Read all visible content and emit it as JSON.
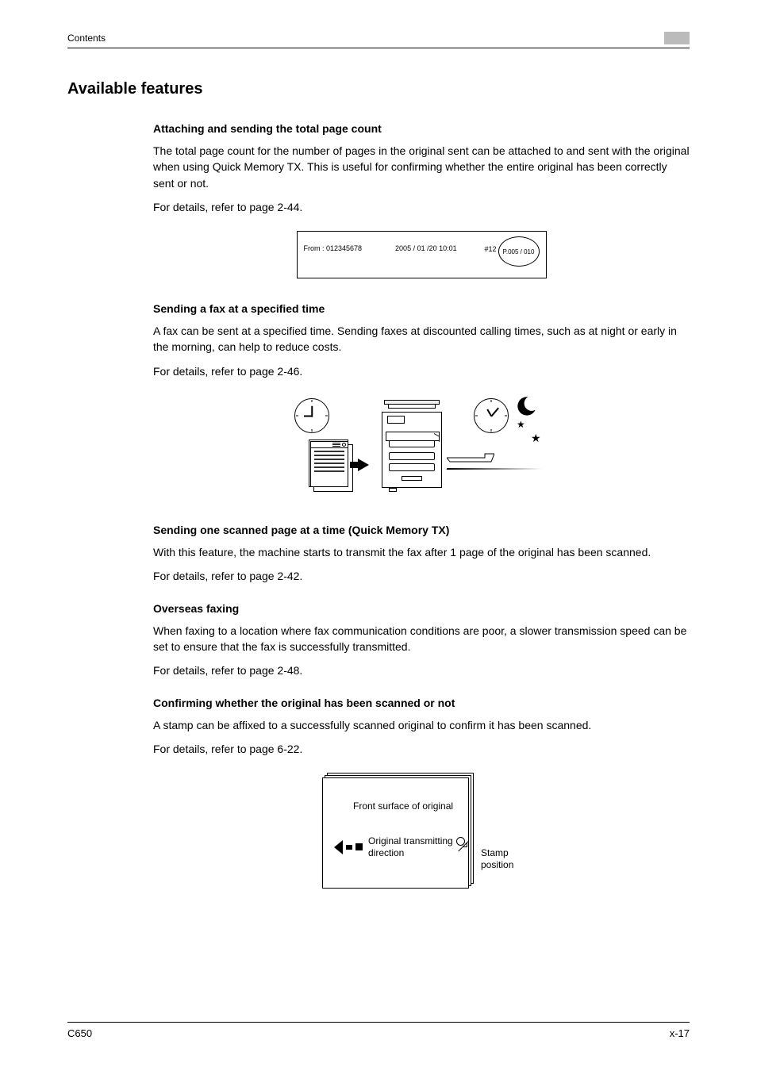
{
  "header": {
    "left": "Contents"
  },
  "title": "Available features",
  "sections": [
    {
      "heading": "Attaching and sending the total page count",
      "para1": "The total page count for the number of pages in the original sent can be attached to and sent with the original when using Quick Memory TX. This is useful for confirming whether the entire original has been correctly sent or not.",
      "para2": "For details, refer to page 2-44."
    },
    {
      "heading": "Sending a fax at a specified time",
      "para1": "A fax can be sent at a specified time. Sending faxes at discounted calling times, such as at night or early in the morning, can help to reduce costs.",
      "para2": "For details, refer to page 2-46."
    },
    {
      "heading": "Sending one scanned page at a time (Quick Memory TX)",
      "para1": "With this feature, the machine starts to transmit the fax after 1 page of the original has been scanned.",
      "para2": "For details, refer to page 2-42."
    },
    {
      "heading": "Overseas faxing",
      "para1": "When faxing to a location where fax communication conditions are poor, a slower transmission speed can be set to ensure that the fax is successfully transmitted.",
      "para2": "For details, refer to page 2-48."
    },
    {
      "heading": "Confirming whether the original has been scanned or not",
      "para1": "A stamp can be affixed to a successfully scanned original to confirm it has been scanned.",
      "para2": "For details, refer to page 6-22."
    }
  ],
  "fig1": {
    "from": "From : 012345678",
    "date": "2005 / 01 /20 10:01",
    "hash": "#12",
    "pcount": "P.005 / 010"
  },
  "fig3": {
    "label1": "Front surface of original",
    "label2a": "Original transmitting",
    "label2b": "direction",
    "stamp1": "Stamp",
    "stamp2": "position"
  },
  "footer": {
    "left": "C650",
    "right": "x-17"
  }
}
